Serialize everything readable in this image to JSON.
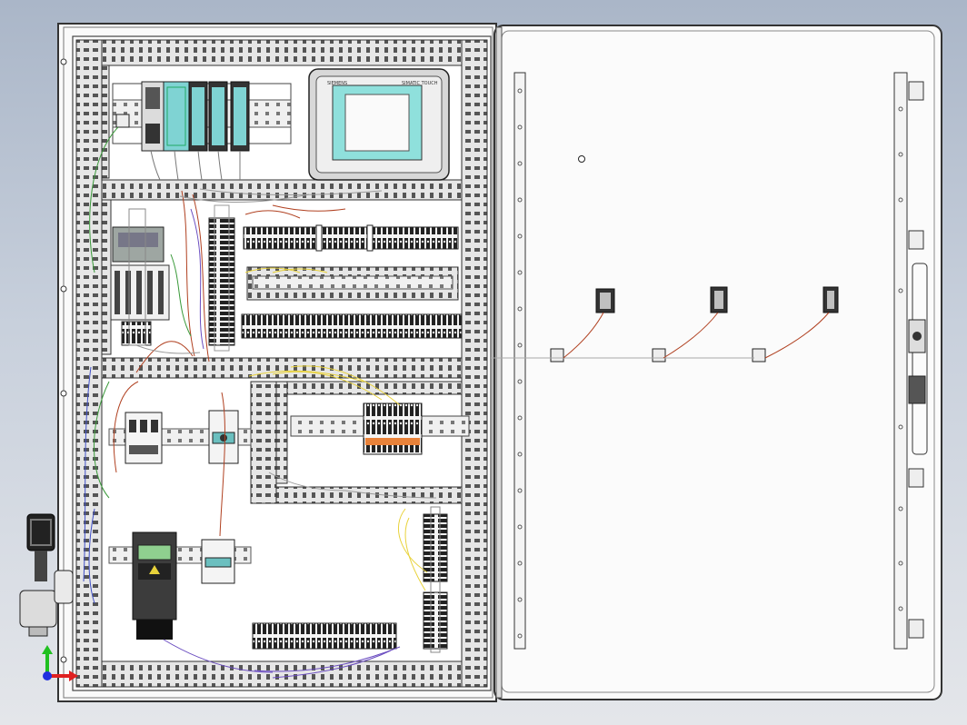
{
  "hmi": {
    "brand_text": "SIEMENS",
    "model_text": "SIMATIC TOUCH"
  },
  "colors": {
    "background_top": "#aab6c8",
    "background_bottom": "#e4e6ea",
    "enclosure": "#ffffff",
    "duct": "#e2e2e2",
    "plc_module": "#7fd3d3",
    "hmi_screen": "#8fe0dc",
    "wire_red": "#b04020",
    "wire_yellow": "#e8d23a",
    "wire_green": "#3a9a3a",
    "wire_purple": "#6a4cc0",
    "wire_blue": "#4050c8",
    "triad_x": "#e02020",
    "triad_y": "#20c020",
    "triad_z": "#2030e0"
  },
  "icons": {
    "axis_triad": "axis-triad-icon",
    "door_handle": "door-handle-icon",
    "cable_gland": "cable-gland-icon"
  }
}
